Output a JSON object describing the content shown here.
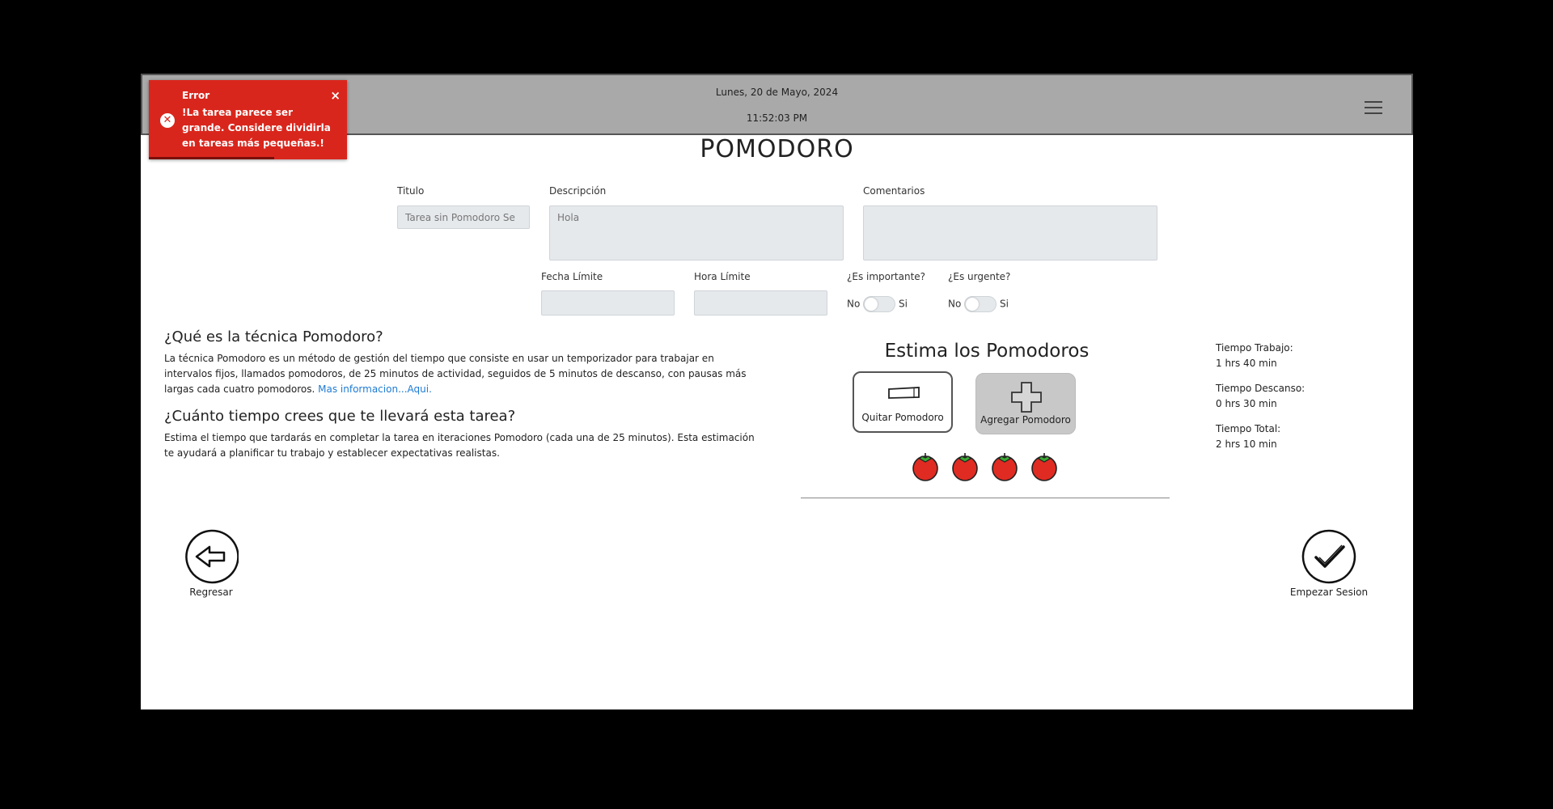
{
  "header": {
    "date": "Lunes, 20 de Mayo, 2024",
    "time": "11:52:03 PM",
    "menu_icon": "hamburger-icon"
  },
  "toast": {
    "title": "Error",
    "message": "!La tarea parece ser grande. Considere dividirla en tareas más pequeñas.!",
    "close": "×",
    "icon": "error-circle-icon",
    "color": "#d9261c"
  },
  "page_title": "POMODORO",
  "form": {
    "titulo_label": "Titulo",
    "titulo_value": "Tarea sin Pomodoro Se",
    "descripcion_label": "Descripción",
    "descripcion_value": "Hola",
    "comentarios_label": "Comentarios",
    "comentarios_value": "",
    "fecha_label": "Fecha Límite",
    "hora_label": "Hora Límite",
    "importante_label": "¿Es importante?",
    "urgente_label": "¿Es urgente?",
    "no": "No",
    "si": "Si"
  },
  "info": {
    "heading1": "¿Qué es la técnica Pomodoro?",
    "para1": "La técnica Pomodoro es un método de gestión del tiempo que consiste en usar un temporizador para trabajar en intervalos fijos, llamados pomodoros, de 25 minutos de actividad, seguidos de 5 minutos de descanso, con pausas más largas cada cuatro pomodoros.",
    "link": "Mas informacion...Aqui.",
    "heading2": "¿Cuánto tiempo crees que te llevará esta tarea?",
    "para2": "Estima el tiempo que tardarás en completar la tarea en iteraciones Pomodoro (cada una de 25 minutos). Esta estimación te ayudará a planificar tu trabajo y establecer expectativas realistas."
  },
  "estimate": {
    "title": "Estima los Pomodoros",
    "remove_label": "Quitar Pomodoro",
    "add_label": "Agregar Pomodoro",
    "tomato_count": 4
  },
  "stats": {
    "work_label": "Tiempo Trabajo:",
    "work_value": "1 hrs 40 min",
    "rest_label": "Tiempo Descanso:",
    "rest_value": "0 hrs 30 min",
    "total_label": "Tiempo Total:",
    "total_value": "2 hrs 10 min"
  },
  "nav": {
    "back_label": "Regresar",
    "start_label": "Empezar Sesion"
  }
}
